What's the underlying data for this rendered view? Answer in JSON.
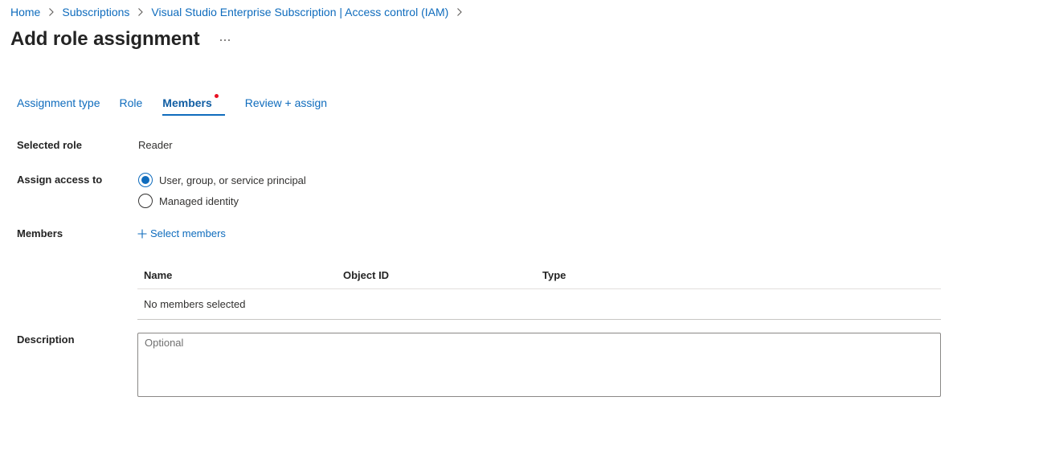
{
  "breadcrumb": [
    {
      "label": "Home"
    },
    {
      "label": "Subscriptions"
    },
    {
      "label": "Visual Studio Enterprise Subscription | Access control (IAM)"
    }
  ],
  "page": {
    "title": "Add role assignment",
    "more_icon": "ellipsis-icon"
  },
  "tabs": [
    {
      "label": "Assignment type"
    },
    {
      "label": "Role"
    },
    {
      "label": "Members",
      "active": true,
      "required_indicator": true
    },
    {
      "label": "Review + assign"
    }
  ],
  "form": {
    "selected_role_label": "Selected role",
    "selected_role_value": "Reader",
    "assign_access_label": "Assign access to",
    "assign_options": [
      {
        "label": "User, group, or service principal",
        "checked": true
      },
      {
        "label": "Managed identity",
        "checked": false
      }
    ],
    "members_label": "Members",
    "select_members_label": "Select members",
    "table": {
      "columns": [
        "Name",
        "Object ID",
        "Type"
      ],
      "empty_message": "No members selected"
    },
    "description_label": "Description",
    "description_placeholder": "Optional",
    "description_value": ""
  },
  "colors": {
    "accent": "#0f6cbd",
    "required_dot": "#e81123",
    "text": "#323130"
  }
}
